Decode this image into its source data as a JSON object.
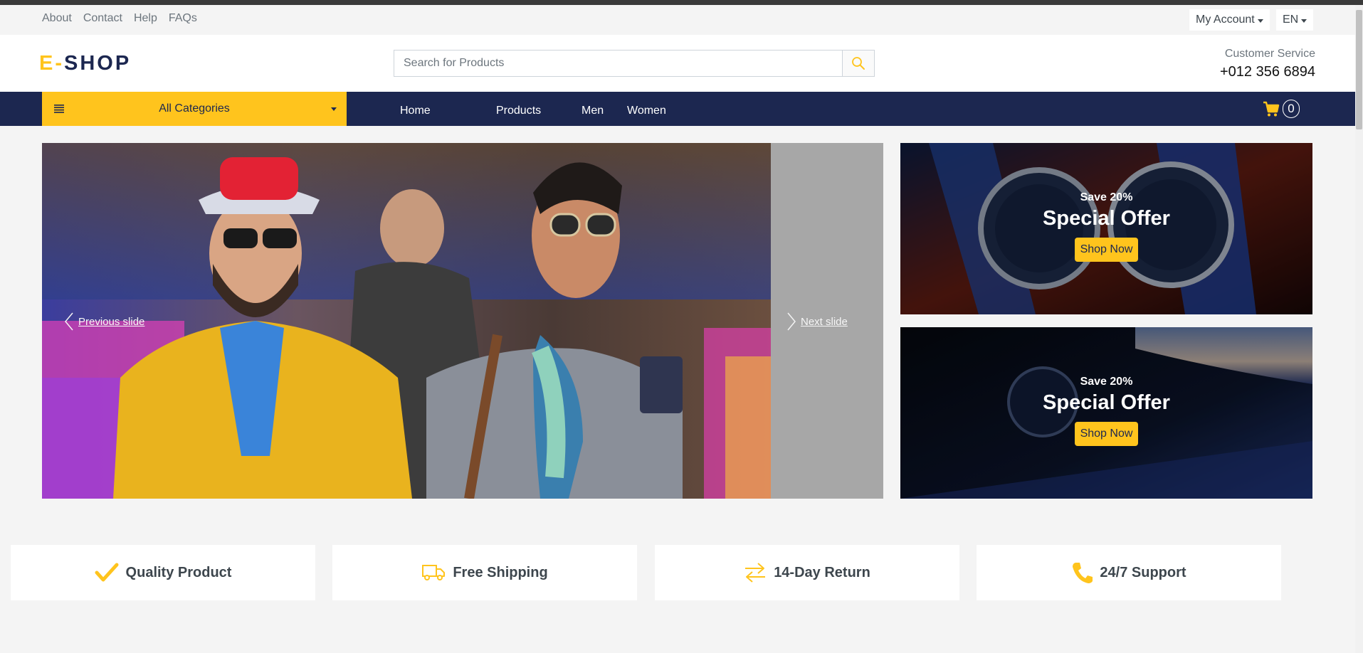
{
  "topbar": {
    "links": [
      "About",
      "Contact",
      "Help",
      "FAQs"
    ],
    "account_label": "My Account",
    "language_label": "EN"
  },
  "header": {
    "logo_prefix": "E-",
    "logo_main": "SHOP",
    "search_placeholder": "Search for Products",
    "customer_service_label": "Customer Service",
    "customer_service_phone": "+012 356 6894"
  },
  "nav": {
    "categories_label": "All Categories",
    "links": [
      "Home",
      "Products",
      "Men",
      "Women"
    ],
    "cart_count": "0"
  },
  "carousel": {
    "prev_label": "Previous slide",
    "next_label": "Next slide"
  },
  "offers": [
    {
      "save": "Save 20%",
      "title": "Special Offer",
      "button": "Shop Now"
    },
    {
      "save": "Save 20%",
      "title": "Special Offer",
      "button": "Shop Now"
    }
  ],
  "features": [
    {
      "icon": "check-icon",
      "label": "Quality Product"
    },
    {
      "icon": "truck-icon",
      "label": "Free Shipping"
    },
    {
      "icon": "exchange-arrows-icon",
      "label": "14-Day Return"
    },
    {
      "icon": "phone-icon",
      "label": "24/7 Support"
    }
  ],
  "colors": {
    "accent": "#ffc41d",
    "navy": "#1c2750",
    "text": "#3d464d"
  }
}
